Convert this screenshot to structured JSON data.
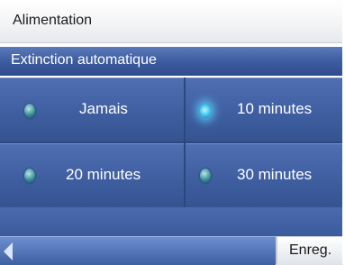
{
  "header": {
    "title": "Alimentation"
  },
  "section": {
    "label": "Extinction automatique"
  },
  "options": [
    {
      "label": "Jamais",
      "selected": false
    },
    {
      "label": "10 minutes",
      "selected": true
    },
    {
      "label": "20 minutes",
      "selected": false
    },
    {
      "label": "30 minutes",
      "selected": false
    }
  ],
  "footer": {
    "save_label": "Enreg.",
    "back_icon": "left-arrow-icon"
  },
  "colors": {
    "accent_blue": "#3e5d9f",
    "header_bar": "#3b5a9d",
    "selected_glow": "#3fc8ef"
  }
}
